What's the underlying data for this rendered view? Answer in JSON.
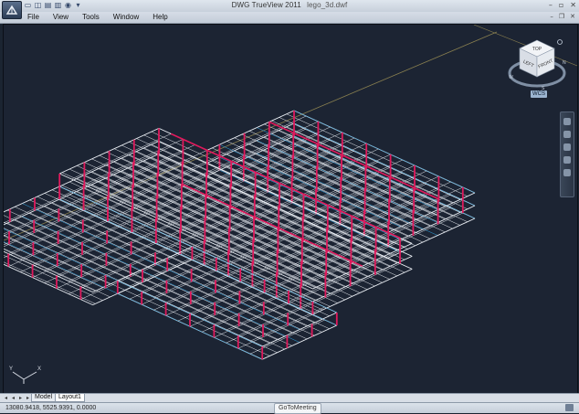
{
  "window": {
    "app_title": "DWG TrueView 2011",
    "document": "lego_3d.dwf"
  },
  "menu": {
    "items": [
      "File",
      "View",
      "Tools",
      "Window",
      "Help"
    ]
  },
  "viewcube": {
    "faces": {
      "top": "TOP",
      "left": "LEFT",
      "front": "FRONT"
    },
    "compass": {
      "north": "N",
      "west": "W",
      "south": "S"
    },
    "wcs_label": "WCS"
  },
  "ucs": {
    "x_label": "X",
    "y_label": "Y"
  },
  "tabs": {
    "model": "Model",
    "layout1": "Layout1",
    "active": "Layout1"
  },
  "status": {
    "coordinates": "13080.9418, 5525.9391, 0.0000",
    "gotomeeting": "GoToMeeting"
  },
  "colors": {
    "viewport_bg": "#1c2433",
    "frame_white": "#e8ecf2",
    "column_magenta": "#e0195c",
    "beam_cyan": "#2fa8e8",
    "axis_line": "#8a8050"
  }
}
